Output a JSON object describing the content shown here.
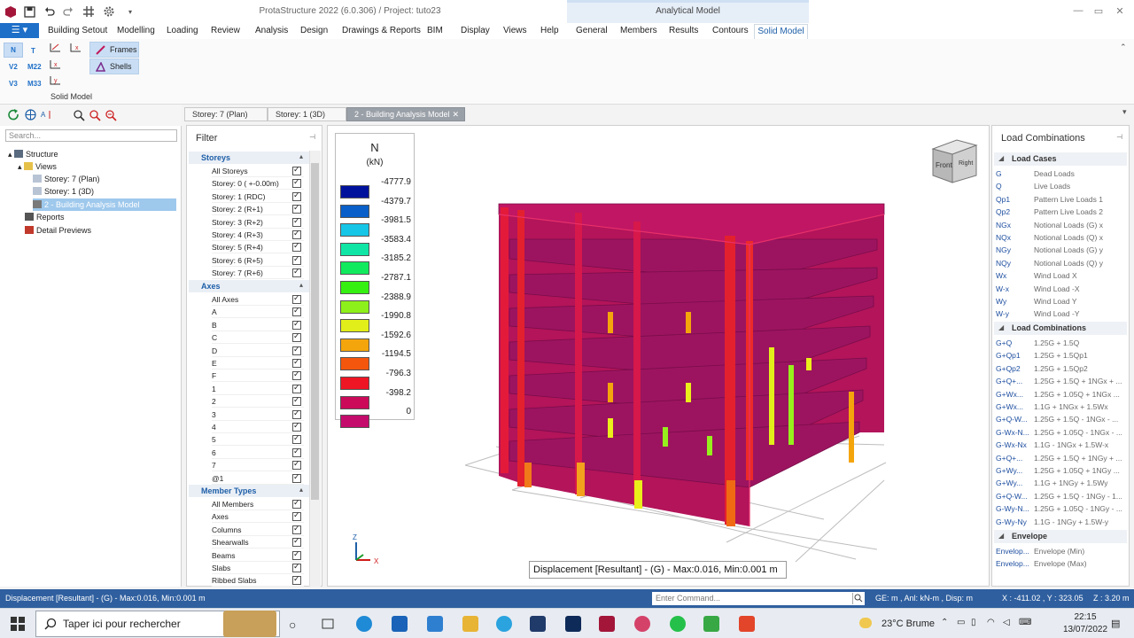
{
  "app": {
    "title": "ProtaStructure 2022 (6.0.306) / Project: tuto23",
    "context_tab_group": "Analytical Model"
  },
  "ribbon_tabs": [
    "Building Setout",
    "Modelling",
    "Loading",
    "Review",
    "Analysis",
    "Design",
    "Drawings & Reports",
    "BIM",
    "Display",
    "Views",
    "Help",
    "General",
    "Members",
    "Results",
    "Contours",
    "Solid Model"
  ],
  "ribbon": {
    "force_buttons": [
      "N",
      "T",
      "V2",
      "M22",
      "V3",
      "M33"
    ],
    "frames_label": "Frames",
    "shells_label": "Shells",
    "group_label": "Solid Model"
  },
  "left_panel": {
    "search_placeholder": "Search...",
    "tree": {
      "structure": "Structure",
      "views": "Views",
      "view1": "Storey: 7 (Plan)",
      "view2": "Storey: 1 (3D)",
      "view3": "2 - Building Analysis Model",
      "reports": "Reports",
      "details": "Detail Previews"
    }
  },
  "doc_tabs": [
    "Storey: 7 (Plan)",
    "Storey: 1 (3D)",
    "2 - Building Analysis Model"
  ],
  "filter": {
    "title": "Filter",
    "storeys_header": "Storeys",
    "storeys": [
      "All Storeys",
      "Storey: 0 ( +-0.00m)",
      "Storey: 1 (RDC)",
      "Storey: 2 (R+1)",
      "Storey: 3 (R+2)",
      "Storey: 4 (R+3)",
      "Storey: 5 (R+4)",
      "Storey: 6 (R+5)",
      "Storey: 7 (R+6)"
    ],
    "axes_header": "Axes",
    "axes": [
      "All Axes",
      "A",
      "B",
      "C",
      "D",
      "E",
      "F",
      "1",
      "2",
      "3",
      "4",
      "5",
      "6",
      "7",
      "@1"
    ],
    "members_header": "Member Types",
    "members": [
      "All Members",
      "Axes",
      "Columns",
      "Shearwalls",
      "Beams",
      "Slabs",
      "Ribbed Slabs"
    ]
  },
  "legend": {
    "title": "N",
    "unit": "(kN)",
    "entries": [
      {
        "value": "-4777.9",
        "color": "#00129c"
      },
      {
        "value": "-4379.7",
        "color": "#0a5fc8"
      },
      {
        "value": "-3981.5",
        "color": "#16c6e6"
      },
      {
        "value": "-3583.4",
        "color": "#0fe6a6"
      },
      {
        "value": "-3185.2",
        "color": "#12ea5e"
      },
      {
        "value": "-2787.1",
        "color": "#36f012"
      },
      {
        "value": "-2388.9",
        "color": "#8ef01a"
      },
      {
        "value": "-1990.8",
        "color": "#e2ee1a"
      },
      {
        "value": "-1592.6",
        "color": "#f4a50c"
      },
      {
        "value": "-1194.5",
        "color": "#f4560e"
      },
      {
        "value": "-796.3",
        "color": "#ee1524"
      },
      {
        "value": "-398.2",
        "color": "#cc0a5a"
      },
      {
        "value": "0",
        "color": "#c40c6c"
      }
    ]
  },
  "viewport": {
    "status_box": "Displacement [Resultant] - (G) -  Max:0.016, Min:0.001 m",
    "cube_front": "Front",
    "cube_right": "Right",
    "axis_z": "Z",
    "axis_x": "X"
  },
  "load_panel": {
    "title": "Load Combinations",
    "cases_header": "Load Cases",
    "cases": [
      {
        "k": "G",
        "v": "Dead Loads"
      },
      {
        "k": "Q",
        "v": "Live Loads"
      },
      {
        "k": "Qp1",
        "v": "Pattern Live Loads 1"
      },
      {
        "k": "Qp2",
        "v": "Pattern Live Loads 2"
      },
      {
        "k": "NGx",
        "v": "Notional Loads (G) x"
      },
      {
        "k": "NQx",
        "v": "Notional Loads (Q) x"
      },
      {
        "k": "NGy",
        "v": "Notional Loads (G) y"
      },
      {
        "k": "NQy",
        "v": "Notional Loads (Q) y"
      },
      {
        "k": "Wx",
        "v": "Wind Load X"
      },
      {
        "k": "W-x",
        "v": "Wind Load -X"
      },
      {
        "k": "Wy",
        "v": "Wind Load Y"
      },
      {
        "k": "W-y",
        "v": "Wind Load -Y"
      }
    ],
    "combos_header": "Load Combinations",
    "combos": [
      {
        "k": "G+Q",
        "v": "1.25G + 1.5Q"
      },
      {
        "k": "G+Qp1",
        "v": "1.25G + 1.5Qp1"
      },
      {
        "k": "G+Qp2",
        "v": "1.25G + 1.5Qp2"
      },
      {
        "k": "G+Q+...",
        "v": "1.25G + 1.5Q + 1NGx + ..."
      },
      {
        "k": "G+Wx...",
        "v": "1.25G + 1.05Q + 1NGx ..."
      },
      {
        "k": "G+Wx...",
        "v": "1.1G + 1NGx + 1.5Wx"
      },
      {
        "k": "G+Q-W...",
        "v": "1.25G + 1.5Q - 1NGx - ..."
      },
      {
        "k": "G-Wx-N...",
        "v": "1.25G + 1.05Q - 1NGx - ..."
      },
      {
        "k": "G-Wx-Nx",
        "v": "1.1G - 1NGx + 1.5W-x"
      },
      {
        "k": "G+Q+...",
        "v": "1.25G + 1.5Q + 1NGy + ..."
      },
      {
        "k": "G+Wy...",
        "v": "1.25G + 1.05Q + 1NGy ..."
      },
      {
        "k": "G+Wy...",
        "v": "1.1G + 1NGy + 1.5Wy"
      },
      {
        "k": "G+Q-W...",
        "v": "1.25G + 1.5Q - 1NGy - 1..."
      },
      {
        "k": "G-Wy-N...",
        "v": "1.25G + 1.05Q - 1NGy - ..."
      },
      {
        "k": "G-Wy-Ny",
        "v": "1.1G - 1NGy + 1.5W-y"
      }
    ],
    "env_header": "Envelope",
    "env": [
      {
        "k": "Envelop...",
        "v": "Envelope (Min)"
      },
      {
        "k": "Envelop...",
        "v": "Envelope (Max)"
      }
    ]
  },
  "statusbar": {
    "left": "Displacement [Resultant] - (G) -  Max:0.016, Min:0.001 m",
    "command_placeholder": "Enter Command...",
    "units": "GE: m , Anl: kN-m , Disp: m",
    "coords": "X : -411.02 , Y : 323.05",
    "z": "Z : 3.20 m"
  },
  "taskbar": {
    "search_placeholder": "Taper ici pour rechercher",
    "weather": "23°C  Brume",
    "time": "22:15",
    "date": "13/07/2022"
  }
}
